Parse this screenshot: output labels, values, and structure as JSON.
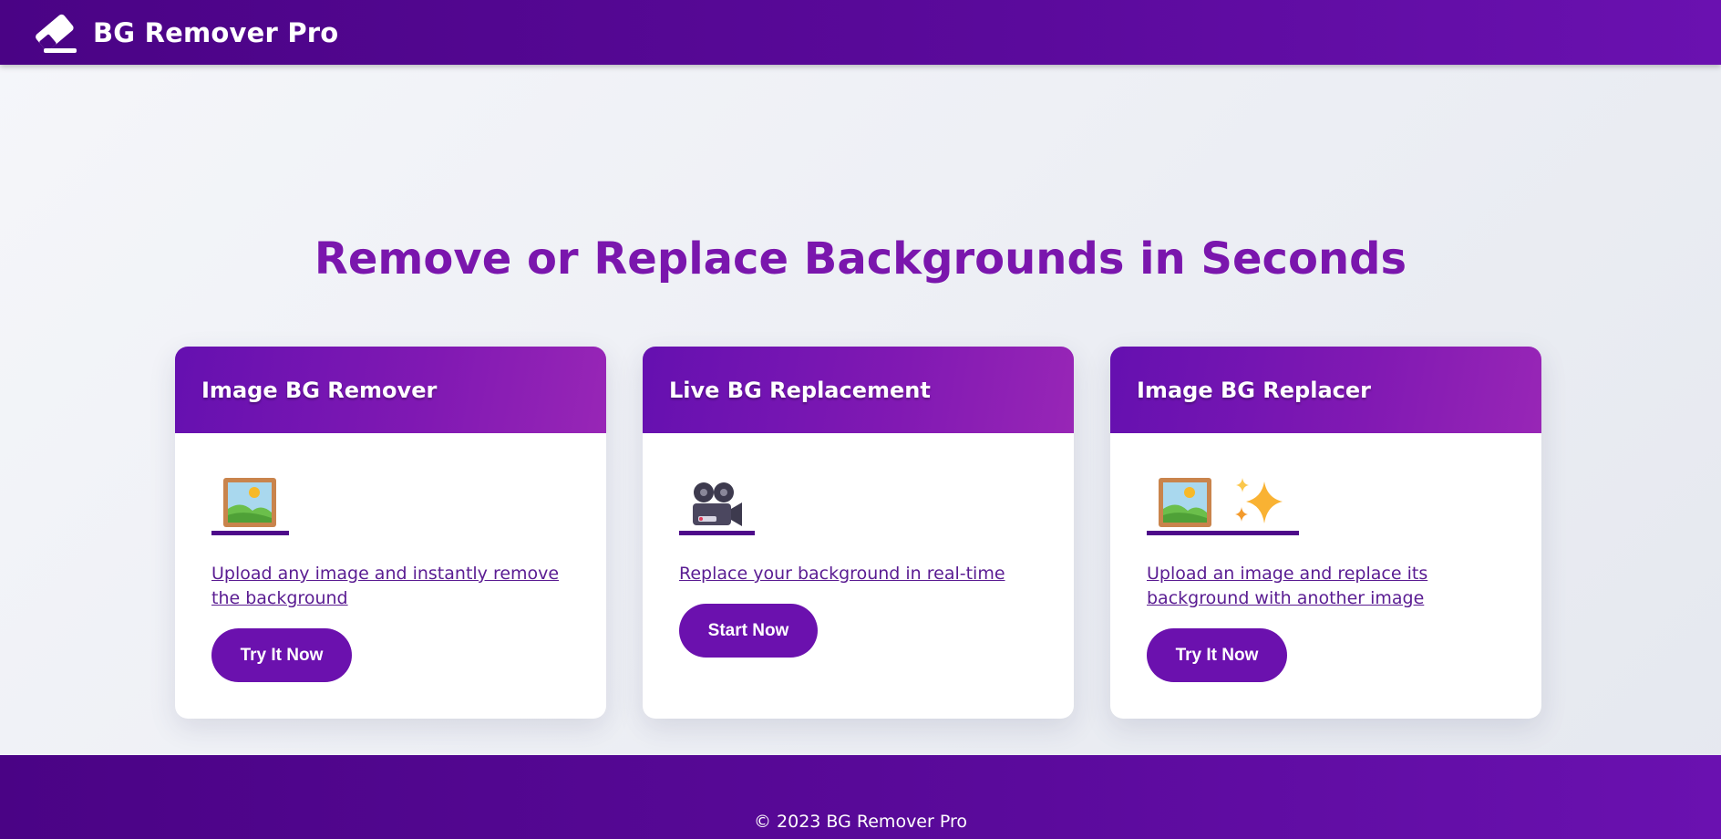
{
  "app": {
    "brand": "BG Remover Pro",
    "logo_icon": "eraser-icon"
  },
  "hero": {
    "headline": "Remove or Replace Backgrounds in Seconds"
  },
  "cards": [
    {
      "title": "Image BG Remover",
      "icons": [
        "framed-picture-icon"
      ],
      "description": "Upload any image and instantly remove the background",
      "button": "Try It Now"
    },
    {
      "title": "Live BG Replacement",
      "icons": [
        "movie-camera-icon"
      ],
      "description": "Replace your background in real-time",
      "button": "Start Now"
    },
    {
      "title": "Image BG Replacer",
      "icons": [
        "framed-picture-icon",
        "sparkles-icon"
      ],
      "description": "Upload an image and replace its background with another image",
      "button": "Try It Now"
    }
  ],
  "footer": {
    "copyright": "© 2023 BG Remover Pro"
  },
  "colors": {
    "header": "#4a0385",
    "accent": "#6b11ae",
    "headline": "#7a16ad",
    "link": "#5a1c92"
  }
}
